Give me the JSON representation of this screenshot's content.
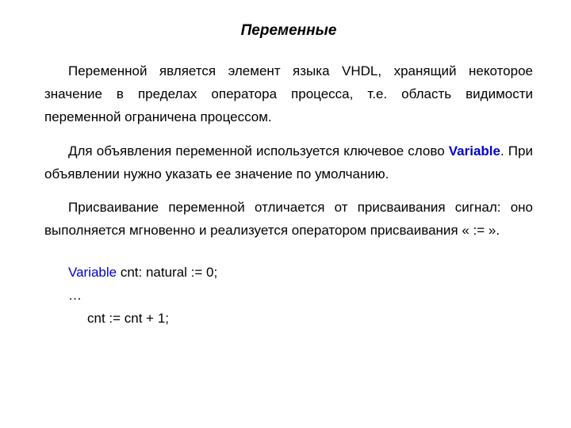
{
  "title": "Переменные",
  "para1_a": "Переменной является элемент языка VHDL, хранящий некоторое значение в пределах оператора процесса, т.е. область видимости переменной ограничена процессом.",
  "para2_a": "Для объявления переменной используется ключевое слово ",
  "para2_kw": "Variable",
  "para2_b": ". При объявлении нужно указать ее значение по умолчанию.",
  "para3_a": "Присваивание переменной отличается от присваивания сигнал: оно выполняется мгновенно и реализуется оператором присваивания « := ».",
  "code": {
    "kw": "Variable",
    "line1_rest": " cnt: natural := 0;",
    "line2": "…",
    "line3": "cnt := cnt + 1;"
  }
}
